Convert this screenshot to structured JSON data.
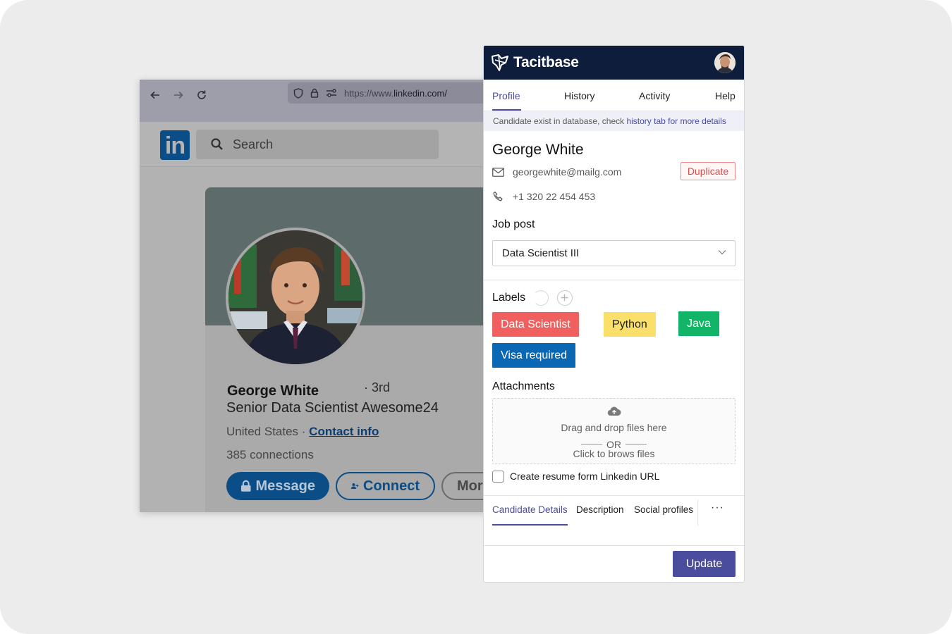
{
  "browser": {
    "url_prefix": "https://www.",
    "url_domain": "linkedin.com/",
    "nav_icons": [
      "back-arrow-icon",
      "forward-arrow-icon",
      "reload-icon"
    ]
  },
  "linkedin": {
    "logo": "in",
    "search_placeholder": "Search",
    "profile": {
      "name": "George White",
      "degree": "· 3rd",
      "headline": "Senior Data Scientist Awesome24",
      "location": "United States · ",
      "contact_link": "Contact info",
      "connections": "385 connections"
    },
    "buttons": {
      "message": "Message",
      "connect": "Connect",
      "more": "More"
    }
  },
  "panel": {
    "brand": "Tacitbase",
    "tabs": [
      "Profile",
      "History",
      "Activity",
      "Help"
    ],
    "active_tab": "Profile",
    "notice": {
      "prefix": "Candidate exist in database, check ",
      "link": "history tab",
      "suffix": " for more details"
    },
    "candidate": {
      "name": "George White",
      "email": "georgewhite@mailg.com",
      "phone": "+1 320 22 454 453",
      "badge": "Duplicate"
    },
    "job_post": {
      "label": "Job post",
      "value": "Data Scientist III"
    },
    "labels": {
      "title": "Labels",
      "items": [
        {
          "text": "Data Scientist",
          "color": "#f0605e"
        },
        {
          "text": "Python",
          "color": "#fbdf6b"
        },
        {
          "text": "Java",
          "color": "#12b567"
        },
        {
          "text": "Visa required",
          "color": "#0a67b3"
        }
      ]
    },
    "attachments": {
      "title": "Attachments",
      "drop_text": "Drag and drop files here",
      "or_text": "OR",
      "browse_text": "Click to brows files"
    },
    "checkbox_label": "Create resume form Linkedin URL",
    "bottom_tabs": [
      "Candidate Details",
      "Description",
      "Social profiles"
    ],
    "more_label": "···",
    "update_button": "Update",
    "accent_color": "#4a4c9e",
    "header_color": "#0f1d3d"
  }
}
